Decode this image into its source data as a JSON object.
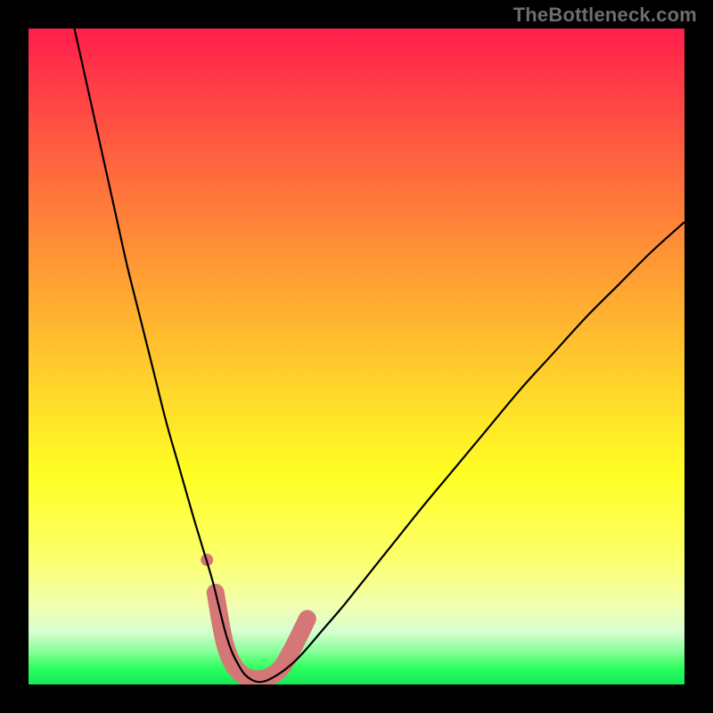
{
  "watermark": "TheBottleneck.com",
  "chart_data": {
    "type": "line",
    "title": "",
    "xlabel": "",
    "ylabel": "",
    "xlim": [
      0,
      100
    ],
    "ylim": [
      0,
      100
    ],
    "grid": false,
    "legend": false,
    "background": "heatmap-gradient",
    "gradient_stops": [
      {
        "pct": 0,
        "color": "#ff1e4b"
      },
      {
        "pct": 22,
        "color": "#ff6a3d"
      },
      {
        "pct": 55,
        "color": "#ffd62a"
      },
      {
        "pct": 80,
        "color": "#fcff66"
      },
      {
        "pct": 95,
        "color": "#86ff97"
      },
      {
        "pct": 100,
        "color": "#14e85a"
      }
    ],
    "series": [
      {
        "name": "bottleneck-curve",
        "color": "#000000",
        "x": [
          7,
          9,
          11,
          13,
          15,
          17,
          19,
          21,
          23,
          25,
          26.5,
          28,
          29,
          30,
          31,
          32,
          33,
          34.5,
          36,
          38,
          40,
          42,
          45,
          48,
          52,
          56,
          60,
          65,
          70,
          75,
          80,
          85,
          90,
          95,
          100
        ],
        "y": [
          100,
          91,
          82,
          73,
          64,
          56,
          48,
          40,
          33,
          26,
          21,
          16,
          12,
          8,
          5,
          3,
          1.5,
          0.5,
          0.5,
          1.5,
          3,
          5,
          8.5,
          12,
          17,
          22,
          27,
          33,
          39,
          45,
          50.5,
          56,
          61,
          66,
          70.5
        ]
      }
    ],
    "annotations": [
      {
        "name": "valley-marker",
        "type": "path",
        "color": "#d67777",
        "stroke_width": 20,
        "points": [
          {
            "x": 28.5,
            "y": 14
          },
          {
            "x": 30,
            "y": 6
          },
          {
            "x": 32,
            "y": 2
          },
          {
            "x": 35,
            "y": 0.8
          },
          {
            "x": 38,
            "y": 2
          },
          {
            "x": 40,
            "y": 5
          },
          {
            "x": 42.5,
            "y": 10
          }
        ]
      },
      {
        "name": "valley-marker-dot",
        "type": "dot",
        "color": "#d67777",
        "radius": 7,
        "x": 27.2,
        "y": 19
      }
    ]
  }
}
